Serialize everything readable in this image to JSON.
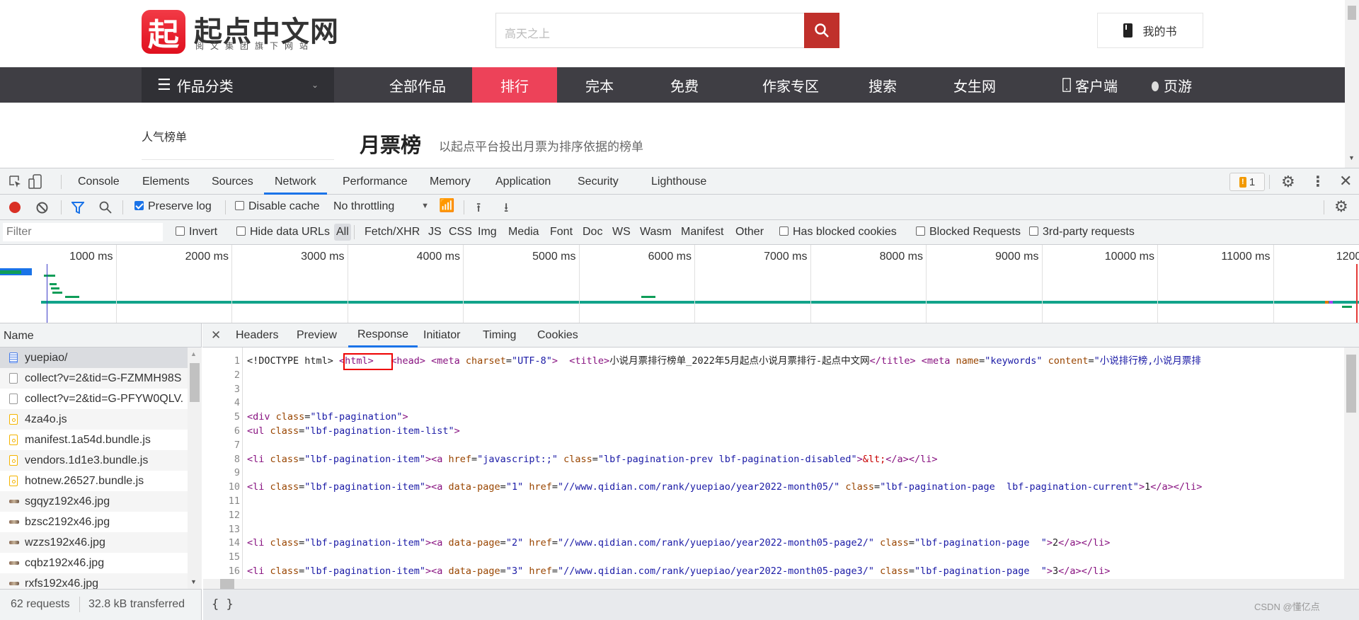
{
  "site": {
    "logo_char": "起",
    "logo_name": "起点中文网",
    "logo_sub": "阅文集团旗下网站",
    "search_placeholder": "高天之上",
    "mybook_label": "我的书",
    "category_label": "作品分类",
    "nav": [
      "全部作品",
      "排行",
      "完本",
      "免费",
      "作家专区",
      "搜索",
      "女生网",
      "客户端",
      "页游"
    ],
    "active_nav": "排行",
    "side_link": "人气榜单",
    "rank_title": "月票榜",
    "rank_desc": "以起点平台投出月票为排序依据的榜单",
    "colors": {
      "brand": "#ed4259",
      "search_button": "#c0302b",
      "nav_bg": "#3f3e44"
    }
  },
  "devtools": {
    "tabs": [
      "Console",
      "Elements",
      "Sources",
      "Network",
      "Performance",
      "Memory",
      "Application",
      "Security",
      "Lighthouse"
    ],
    "active_tab": "Network",
    "issues_count": "1",
    "toolbar": {
      "preserve_log": "Preserve log",
      "preserve_log_checked": true,
      "disable_cache": "Disable cache",
      "disable_cache_checked": false,
      "throttling": "No throttling"
    },
    "filter": {
      "placeholder": "Filter",
      "invert": "Invert",
      "hide_data_urls": "Hide data URLs",
      "types": [
        "All",
        "Fetch/XHR",
        "JS",
        "CSS",
        "Img",
        "Media",
        "Font",
        "Doc",
        "WS",
        "Wasm",
        "Manifest",
        "Other"
      ],
      "active_type": "All",
      "has_blocked_cookies": "Has blocked cookies",
      "blocked_requests": "Blocked Requests",
      "third_party": "3rd-party requests"
    },
    "timeline_ticks": [
      "1000 ms",
      "2000 ms",
      "3000 ms",
      "4000 ms",
      "5000 ms",
      "6000 ms",
      "7000 ms",
      "8000 ms",
      "9000 ms",
      "10000 ms",
      "11000 ms",
      "12000 ms"
    ],
    "name_header": "Name",
    "requests": [
      {
        "name": "yuepiao/",
        "type": "doc"
      },
      {
        "name": "collect?v=2&tid=G-FZMMH98S",
        "type": "other"
      },
      {
        "name": "collect?v=2&tid=G-PFYW0QLV.",
        "type": "other"
      },
      {
        "name": "4za4o.js",
        "type": "js"
      },
      {
        "name": "manifest.1a54d.bundle.js",
        "type": "js"
      },
      {
        "name": "vendors.1d1e3.bundle.js",
        "type": "js"
      },
      {
        "name": "hotnew.26527.bundle.js",
        "type": "js"
      },
      {
        "name": "sgqyz192x46.jpg",
        "type": "img"
      },
      {
        "name": "bzsc2192x46.jpg",
        "type": "img"
      },
      {
        "name": "wzzs192x46.jpg",
        "type": "img"
      },
      {
        "name": "cqbz192x46.jpg",
        "type": "img"
      },
      {
        "name": "rxfs192x46.jpg",
        "type": "img"
      }
    ],
    "detail_tabs": [
      "Headers",
      "Preview",
      "Response",
      "Initiator",
      "Timing",
      "Cookies"
    ],
    "active_detail_tab": "Response",
    "status": {
      "requests": "62 requests",
      "transferred": "32.8 kB transferred"
    },
    "pretty_print": "{ }",
    "response_lines": [
      {
        "n": "1",
        "tokens": [
          [
            "txt",
            "<!DOCTYPE html> "
          ],
          [
            "tag",
            "<html>"
          ],
          [
            "txt",
            "   "
          ],
          [
            "tag",
            "<head>"
          ],
          [
            "txt",
            " "
          ],
          [
            "tag",
            "<meta "
          ],
          [
            "attr",
            "charset"
          ],
          [
            "txt",
            "="
          ],
          [
            "val",
            "\"UTF-8\""
          ],
          [
            "tag",
            ">"
          ],
          [
            "txt",
            "  "
          ],
          [
            "tag",
            "<title>"
          ],
          [
            "txt",
            "小说月票排行榜单_2022年5月起点小说月票排行-起点中文网"
          ],
          [
            "tag",
            "</title>"
          ],
          [
            "txt",
            " "
          ],
          [
            "tag",
            "<meta "
          ],
          [
            "attr",
            "name"
          ],
          [
            "txt",
            "="
          ],
          [
            "val",
            "\"keywords\""
          ],
          [
            "txt",
            " "
          ],
          [
            "attr",
            "content"
          ],
          [
            "txt",
            "="
          ],
          [
            "val",
            "\"小说排行榜,小说月票排"
          ]
        ]
      },
      {
        "n": "2",
        "tokens": []
      },
      {
        "n": "3",
        "tokens": []
      },
      {
        "n": "4",
        "tokens": []
      },
      {
        "n": "5",
        "tokens": [
          [
            "tag",
            "<div "
          ],
          [
            "attr",
            "class"
          ],
          [
            "txt",
            "="
          ],
          [
            "val",
            "\"lbf-pagination\""
          ],
          [
            "tag",
            ">"
          ]
        ]
      },
      {
        "n": "6",
        "tokens": [
          [
            "tag",
            "<ul "
          ],
          [
            "attr",
            "class"
          ],
          [
            "txt",
            "="
          ],
          [
            "val",
            "\"lbf-pagination-item-list\""
          ],
          [
            "tag",
            ">"
          ]
        ]
      },
      {
        "n": "7",
        "tokens": []
      },
      {
        "n": "8",
        "tokens": [
          [
            "tag",
            "<li "
          ],
          [
            "attr",
            "class"
          ],
          [
            "txt",
            "="
          ],
          [
            "val",
            "\"lbf-pagination-item\""
          ],
          [
            "tag",
            ">"
          ],
          [
            "tag",
            "<a "
          ],
          [
            "attr",
            "href"
          ],
          [
            "txt",
            "="
          ],
          [
            "val",
            "\"javascript:;\""
          ],
          [
            "txt",
            " "
          ],
          [
            "attr",
            "class"
          ],
          [
            "txt",
            "="
          ],
          [
            "val",
            "\"lbf-pagination-prev lbf-pagination-disabled\""
          ],
          [
            "tag",
            ">"
          ],
          [
            "ent",
            "&lt;"
          ],
          [
            "tag",
            "</a>"
          ],
          [
            "tag",
            "</li>"
          ]
        ]
      },
      {
        "n": "9",
        "tokens": []
      },
      {
        "n": "10",
        "tokens": [
          [
            "tag",
            "<li "
          ],
          [
            "attr",
            "class"
          ],
          [
            "txt",
            "="
          ],
          [
            "val",
            "\"lbf-pagination-item\""
          ],
          [
            "tag",
            ">"
          ],
          [
            "tag",
            "<a "
          ],
          [
            "attr",
            "data-page"
          ],
          [
            "txt",
            "="
          ],
          [
            "val",
            "\"1\""
          ],
          [
            "txt",
            " "
          ],
          [
            "attr",
            "href"
          ],
          [
            "txt",
            "="
          ],
          [
            "val",
            "\"//www.qidian.com/rank/yuepiao/year2022-month05/\""
          ],
          [
            "txt",
            " "
          ],
          [
            "attr",
            "class"
          ],
          [
            "txt",
            "="
          ],
          [
            "val",
            "\"lbf-pagination-page  lbf-pagination-current\""
          ],
          [
            "tag",
            ">"
          ],
          [
            "txt",
            "1"
          ],
          [
            "tag",
            "</a>"
          ],
          [
            "tag",
            "</li>"
          ]
        ]
      },
      {
        "n": "11",
        "tokens": []
      },
      {
        "n": "12",
        "tokens": []
      },
      {
        "n": "13",
        "tokens": []
      },
      {
        "n": "14",
        "tokens": [
          [
            "tag",
            "<li "
          ],
          [
            "attr",
            "class"
          ],
          [
            "txt",
            "="
          ],
          [
            "val",
            "\"lbf-pagination-item\""
          ],
          [
            "tag",
            ">"
          ],
          [
            "tag",
            "<a "
          ],
          [
            "attr",
            "data-page"
          ],
          [
            "txt",
            "="
          ],
          [
            "val",
            "\"2\""
          ],
          [
            "txt",
            " "
          ],
          [
            "attr",
            "href"
          ],
          [
            "txt",
            "="
          ],
          [
            "val",
            "\"//www.qidian.com/rank/yuepiao/year2022-month05-page2/\""
          ],
          [
            "txt",
            " "
          ],
          [
            "attr",
            "class"
          ],
          [
            "txt",
            "="
          ],
          [
            "val",
            "\"lbf-pagination-page  \""
          ],
          [
            "tag",
            ">"
          ],
          [
            "txt",
            "2"
          ],
          [
            "tag",
            "</a>"
          ],
          [
            "tag",
            "</li>"
          ]
        ]
      },
      {
        "n": "15",
        "tokens": []
      },
      {
        "n": "16",
        "tokens": [
          [
            "tag",
            "<li "
          ],
          [
            "attr",
            "class"
          ],
          [
            "txt",
            "="
          ],
          [
            "val",
            "\"lbf-pagination-item\""
          ],
          [
            "tag",
            ">"
          ],
          [
            "tag",
            "<a "
          ],
          [
            "attr",
            "data-page"
          ],
          [
            "txt",
            "="
          ],
          [
            "val",
            "\"3\""
          ],
          [
            "txt",
            " "
          ],
          [
            "attr",
            "href"
          ],
          [
            "txt",
            "="
          ],
          [
            "val",
            "\"//www.qidian.com/rank/yuepiao/year2022-month05-page3/\""
          ],
          [
            "txt",
            " "
          ],
          [
            "attr",
            "class"
          ],
          [
            "txt",
            "="
          ],
          [
            "val",
            "\"lbf-pagination-page  \""
          ],
          [
            "tag",
            ">"
          ],
          [
            "txt",
            "3"
          ],
          [
            "tag",
            "</a>"
          ],
          [
            "tag",
            "</li>"
          ]
        ]
      }
    ],
    "highlight_annotation": "<html>"
  },
  "watermark": "CSDN @懂亿点"
}
